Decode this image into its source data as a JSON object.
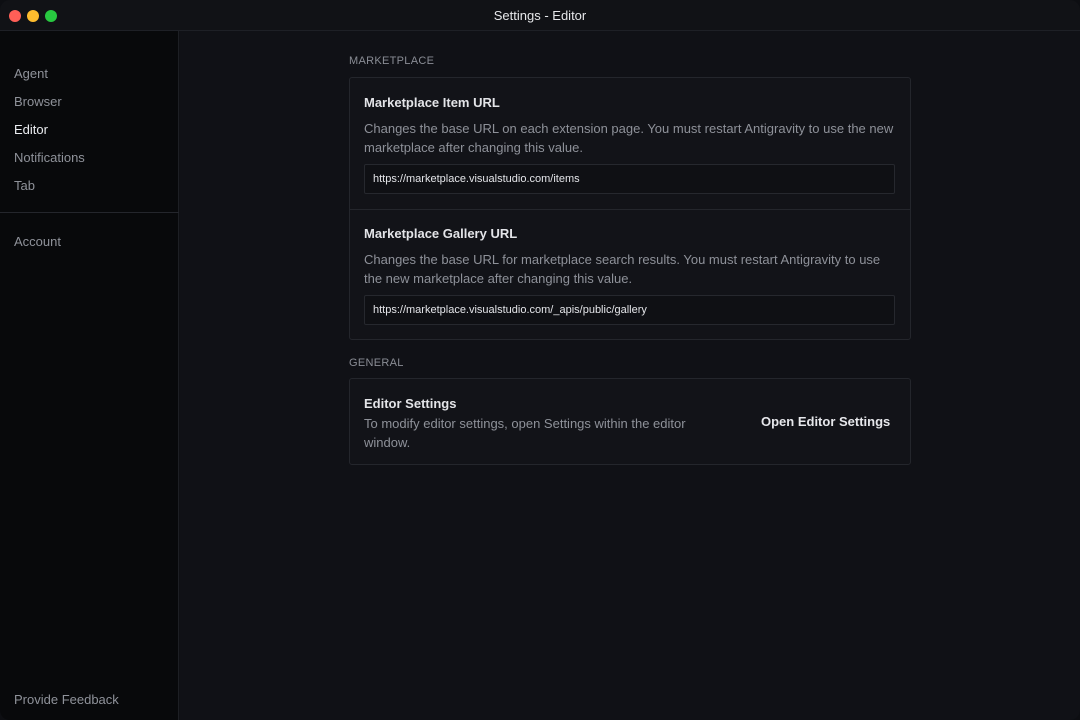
{
  "window": {
    "title": "Settings - Editor"
  },
  "sidebar": {
    "items": [
      {
        "label": "Agent"
      },
      {
        "label": "Browser"
      },
      {
        "label": "Editor"
      },
      {
        "label": "Notifications"
      },
      {
        "label": "Tab"
      }
    ],
    "active": "Editor",
    "account_label": "Account",
    "feedback_label": "Provide Feedback"
  },
  "marketplace": {
    "section_label": "MARKETPLACE",
    "item_url": {
      "title": "Marketplace Item URL",
      "description": "Changes the base URL on each extension page. You must restart Antigravity to use the new marketplace after changing this value.",
      "value": "https://marketplace.visualstudio.com/items"
    },
    "gallery_url": {
      "title": "Marketplace Gallery URL",
      "description": "Changes the base URL for marketplace search results. You must restart Antigravity to use the new marketplace after changing this value.",
      "value": "https://marketplace.visualstudio.com/_apis/public/gallery"
    }
  },
  "general": {
    "section_label": "GENERAL",
    "editor_settings": {
      "title": "Editor Settings",
      "description": "To modify editor settings, open Settings within the editor window.",
      "button_label": "Open Editor Settings"
    }
  },
  "colors": {
    "traffic_red": "#ff5f57",
    "traffic_yellow": "#febc2e",
    "traffic_green": "#28c840"
  }
}
